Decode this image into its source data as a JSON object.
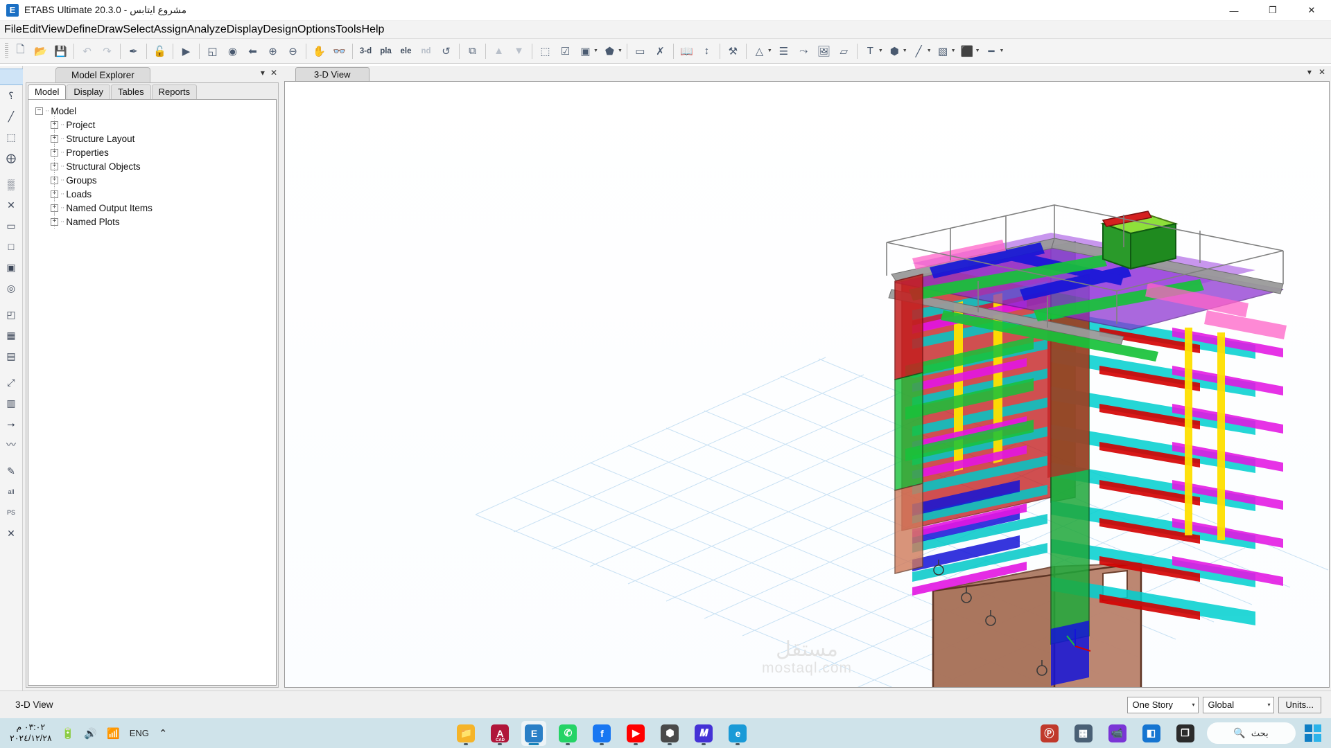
{
  "window": {
    "title": "ETABS Ultimate 20.3.0 - مشروع ايتابس",
    "app_icon": "E",
    "minimize": "—",
    "maximize": "❐",
    "close": "✕"
  },
  "menubar": {
    "items": [
      {
        "label": "File",
        "mnemonic": "F",
        "active": true
      },
      {
        "label": "Edit",
        "mnemonic": "E",
        "active": false
      },
      {
        "label": "View",
        "mnemonic": "V",
        "active": false
      },
      {
        "label": "Define",
        "mnemonic": "D",
        "active": false
      },
      {
        "label": "Draw",
        "mnemonic": "r",
        "active": false
      },
      {
        "label": "Select",
        "mnemonic": "S",
        "active": false
      },
      {
        "label": "Assign",
        "mnemonic": "A",
        "active": false
      },
      {
        "label": "Analyze",
        "mnemonic": "y",
        "active": false
      },
      {
        "label": "Display",
        "mnemonic": "i",
        "active": false
      },
      {
        "label": "Design",
        "mnemonic": "g",
        "active": false
      },
      {
        "label": "Options",
        "mnemonic": "O",
        "active": false
      },
      {
        "label": "Tools",
        "mnemonic": "T",
        "active": false
      },
      {
        "label": "Help",
        "mnemonic": "H",
        "active": false
      }
    ]
  },
  "toolbar": {
    "groups": [
      {
        "items": [
          {
            "name": "new-model-icon",
            "glyph": "🗋",
            "kind": "icon"
          },
          {
            "name": "open-model-icon",
            "glyph": "📂",
            "kind": "icon"
          },
          {
            "name": "save-model-icon",
            "glyph": "💾",
            "kind": "icon"
          }
        ]
      },
      {
        "items": [
          {
            "name": "undo-icon",
            "glyph": "↶",
            "kind": "icon",
            "dim": true
          },
          {
            "name": "redo-icon",
            "glyph": "↷",
            "kind": "icon",
            "dim": true
          }
        ]
      },
      {
        "items": [
          {
            "name": "refresh-view-icon",
            "glyph": "✒",
            "kind": "icon"
          }
        ]
      },
      {
        "items": [
          {
            "name": "lock-model-icon",
            "glyph": "🔓",
            "kind": "icon"
          }
        ]
      },
      {
        "items": [
          {
            "name": "run-analysis-icon",
            "glyph": "▶",
            "kind": "icon"
          }
        ]
      },
      {
        "items": [
          {
            "name": "rubber-band-zoom-icon",
            "glyph": "◱",
            "kind": "icon"
          },
          {
            "name": "restore-full-view-icon",
            "glyph": "◉",
            "kind": "icon"
          },
          {
            "name": "previous-zoom-icon",
            "glyph": "⬅",
            "kind": "icon"
          },
          {
            "name": "zoom-in-icon",
            "glyph": "⊕",
            "kind": "icon"
          },
          {
            "name": "zoom-out-icon",
            "glyph": "⊖",
            "kind": "icon"
          }
        ]
      },
      {
        "items": [
          {
            "name": "pan-icon",
            "glyph": "✋",
            "kind": "icon"
          },
          {
            "name": "set-display-options-icon",
            "glyph": "👓",
            "kind": "icon",
            "dim": true
          }
        ]
      },
      {
        "items": [
          {
            "name": "three-d-view-button",
            "label": "3-d",
            "kind": "text"
          },
          {
            "name": "plan-view-button",
            "label": "pla",
            "kind": "text"
          },
          {
            "name": "elevation-view-button",
            "label": "ele",
            "kind": "text"
          },
          {
            "name": "custom-view-button",
            "label": "nd",
            "kind": "text",
            "dim": true
          },
          {
            "name": "rotate-3d-view-icon",
            "glyph": "↺",
            "kind": "icon"
          }
        ]
      },
      {
        "items": [
          {
            "name": "perspective-toggle-icon",
            "glyph": "⧉",
            "kind": "icon"
          }
        ]
      },
      {
        "items": [
          {
            "name": "move-up-story-icon",
            "glyph": "▲",
            "kind": "icon",
            "dim": true
          },
          {
            "name": "move-down-story-icon",
            "glyph": "▼",
            "kind": "icon",
            "dim": true
          }
        ]
      },
      {
        "items": [
          {
            "name": "set-select-mode-icon",
            "glyph": "⬚",
            "kind": "icon"
          },
          {
            "name": "set-display-checkbox-icon",
            "glyph": "☑",
            "kind": "icon"
          },
          {
            "name": "object-view-options-icon",
            "glyph": "▣",
            "kind": "icon",
            "caret": true
          },
          {
            "name": "extrude-view-icon",
            "glyph": "⬟",
            "kind": "icon",
            "caret": true
          }
        ]
      },
      {
        "items": [
          {
            "name": "show-undeformed-shape-icon",
            "glyph": "▭",
            "kind": "icon"
          },
          {
            "name": "show-deformed-shape-icon",
            "glyph": "✗",
            "kind": "icon"
          }
        ]
      },
      {
        "items": [
          {
            "name": "show-tables-icon",
            "glyph": "📖",
            "kind": "icon"
          },
          {
            "name": "show-forces-diagram-icon",
            "glyph": "↕",
            "kind": "icon"
          }
        ]
      },
      {
        "items": [
          {
            "name": "section-cut-icon",
            "glyph": "⚒",
            "kind": "icon"
          }
        ]
      },
      {
        "items": [
          {
            "name": "show-loads-icon",
            "glyph": "△",
            "kind": "icon",
            "caret": true
          },
          {
            "name": "show-load-pattern-icon",
            "glyph": "☰",
            "kind": "icon"
          },
          {
            "name": "show-influence-lines-icon",
            "glyph": "⤳",
            "kind": "icon"
          },
          {
            "name": "display-image-icon",
            "glyph": "🖼",
            "kind": "icon"
          },
          {
            "name": "display-output-icon",
            "glyph": "▱",
            "kind": "icon"
          }
        ]
      },
      {
        "items": [
          {
            "name": "text-label-icon",
            "glyph": "T",
            "kind": "icon",
            "caret": true
          },
          {
            "name": "point-object-icon",
            "glyph": "⬢",
            "kind": "icon",
            "caret": true
          },
          {
            "name": "line-object-icon",
            "glyph": "╱",
            "kind": "icon",
            "caret": true
          },
          {
            "name": "area-object-icon",
            "glyph": "▧",
            "kind": "icon",
            "caret": true
          },
          {
            "name": "joint-object-icon",
            "glyph": "⬛",
            "kind": "icon",
            "caret": true
          },
          {
            "name": "link-object-icon",
            "glyph": "━",
            "kind": "icon",
            "caret": true
          }
        ]
      }
    ]
  },
  "vertical_toolbar": {
    "items": [
      {
        "name": "pointer-select-tool",
        "glyph": "↖",
        "selected": true
      },
      {
        "name": "select-object-tool",
        "glyph": "⸮",
        "selected": false
      },
      {
        "name": "draw-line-tool",
        "glyph": "╱",
        "selected": false
      },
      {
        "name": "draw-poly-area-tool",
        "glyph": "⬚",
        "selected": false
      },
      {
        "name": "draw-joint-tool",
        "glyph": "⨁",
        "selected": false
      },
      {
        "name": "draw-beam-tool",
        "glyph": "▒",
        "selected": false
      },
      {
        "name": "quick-draw-tool",
        "glyph": "✕",
        "selected": false
      },
      {
        "name": "draw-wall-tool",
        "glyph": "▭",
        "selected": false
      },
      {
        "name": "draw-rect-area-tool",
        "glyph": "□",
        "selected": false
      },
      {
        "name": "draw-quad-area-tool",
        "glyph": "▣",
        "selected": false
      },
      {
        "name": "draw-circular-area-tool",
        "glyph": "◎",
        "selected": false
      },
      {
        "name": "draw-reference-line-tool",
        "glyph": "◰",
        "selected": false
      },
      {
        "name": "draw-grid-tool",
        "glyph": "▦",
        "selected": false
      },
      {
        "name": "draw-dimension-tool",
        "glyph": "▤",
        "selected": false
      },
      {
        "name": "select-intersecting-line-tool",
        "glyph": "⤢",
        "selected": false
      },
      {
        "name": "select-by-table-tool",
        "glyph": "▥",
        "selected": false
      },
      {
        "name": "select-by-support-tool",
        "glyph": "⭢",
        "selected": false
      },
      {
        "name": "select-wave-tool",
        "glyph": "〰",
        "selected": false
      },
      {
        "name": "annotate-pen-tool",
        "glyph": "✎",
        "selected": false
      },
      {
        "name": "select-all-tool",
        "glyph": "all",
        "selected": false
      },
      {
        "name": "previous-selection-tool",
        "glyph": "PS",
        "selected": false
      },
      {
        "name": "clear-selection-tool",
        "glyph": "✕",
        "selected": false
      }
    ]
  },
  "model_explorer": {
    "panel_title": "Model Explorer",
    "float_icon": "▾",
    "close_icon": "✕",
    "tabs": [
      {
        "label": "Model",
        "active": true
      },
      {
        "label": "Display",
        "active": false
      },
      {
        "label": "Tables",
        "active": false
      },
      {
        "label": "Reports",
        "active": false
      }
    ],
    "tree": {
      "root": {
        "label": "Model",
        "expander": "−"
      },
      "children": [
        {
          "label": "Project",
          "expander": "+"
        },
        {
          "label": "Structure Layout",
          "expander": "+"
        },
        {
          "label": "Properties",
          "expander": "+"
        },
        {
          "label": "Structural Objects",
          "expander": "+"
        },
        {
          "label": "Groups",
          "expander": "+"
        },
        {
          "label": "Loads",
          "expander": "+"
        },
        {
          "label": "Named Output Items",
          "expander": "+"
        },
        {
          "label": "Named Plots",
          "expander": "+"
        }
      ]
    }
  },
  "view_pane": {
    "tab_label": "3-D View",
    "float_icon": "▾",
    "close_icon": "✕",
    "watermark_main": "مستقل",
    "watermark_sub": "mostaql.com"
  },
  "statusbar": {
    "view_label": "3-D View",
    "story_select": {
      "value": "One Story",
      "caret": "▾"
    },
    "coord_select": {
      "value": "Global",
      "caret": "▾"
    },
    "units_button": "Units..."
  },
  "taskbar": {
    "clock_time": "٠٣:٠٢ م",
    "clock_date": "٢٠٢٤/١٢/٢٨",
    "tray": [
      {
        "name": "battery-icon",
        "glyph": "🔋"
      },
      {
        "name": "volume-icon",
        "glyph": "🔊"
      },
      {
        "name": "wifi-icon",
        "glyph": "📶"
      },
      {
        "name": "language-indicator",
        "glyph": "ENG"
      },
      {
        "name": "show-hidden-icons-chevron",
        "glyph": "⌃"
      }
    ],
    "apps": [
      {
        "name": "taskbar-file-explorer",
        "glyph": "📁",
        "color": "#f5b429",
        "text": "",
        "active": false
      },
      {
        "name": "taskbar-autocad",
        "glyph": "A",
        "color": "#b0163a",
        "text": "CAD",
        "active": false
      },
      {
        "name": "taskbar-etabs",
        "glyph": "E",
        "color": "#2a7fc6",
        "text": "",
        "active": true
      },
      {
        "name": "taskbar-whatsapp",
        "glyph": "✆",
        "color": "#25d366",
        "text": "",
        "active": false
      },
      {
        "name": "taskbar-facebook",
        "glyph": "f",
        "color": "#1877f2",
        "text": "",
        "active": false
      },
      {
        "name": "taskbar-youtube",
        "glyph": "▶",
        "color": "#ff0000",
        "text": "",
        "active": false
      },
      {
        "name": "taskbar-sketchup",
        "glyph": "⬢",
        "color": "#4a4a4a",
        "text": "",
        "active": false
      },
      {
        "name": "taskbar-mathcad",
        "glyph": "𝑴",
        "color": "#4432d6",
        "text": "",
        "active": false
      },
      {
        "name": "taskbar-microsoft-edge",
        "glyph": "e",
        "color": "#1a9ad7",
        "text": "",
        "active": false
      }
    ],
    "apps_right": [
      {
        "name": "taskbar-psiphon",
        "glyph": "Ⓟ",
        "color": "#c0392b"
      },
      {
        "name": "taskbar-calculator",
        "glyph": "▦",
        "color": "#4a6075"
      },
      {
        "name": "taskbar-video-chat",
        "glyph": "📹",
        "color": "#7a35d6"
      },
      {
        "name": "taskbar-panels-app",
        "glyph": "◧",
        "color": "#1675d1"
      },
      {
        "name": "taskbar-screenshot",
        "glyph": "❐",
        "color": "#2b2b2b"
      }
    ],
    "search_placeholder": "بحث",
    "search_icon": "🔍",
    "start_name": "start-button"
  }
}
